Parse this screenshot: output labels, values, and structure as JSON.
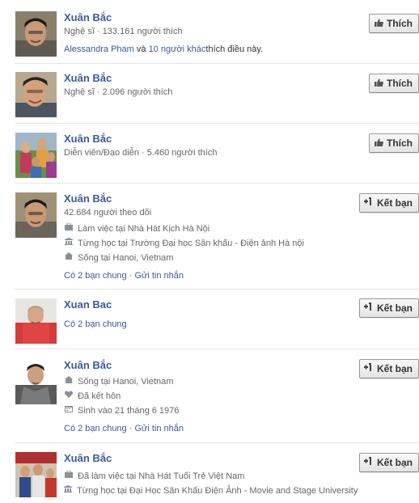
{
  "results": [
    {
      "name": "Xuân Bắc",
      "subtitle": "Nghệ sĩ · 133.161 người thích",
      "social_pre": "Alessandra Pham",
      "social_mid": " và ",
      "social_link": "10 người khác",
      "social_post": " thích điều này.",
      "button": "Thích",
      "button_icon": "thumbs-up-icon"
    },
    {
      "name": "Xuân Bắc",
      "subtitle": "Nghệ sĩ · 2.096 người thích",
      "button": "Thích",
      "button_icon": "thumbs-up-icon"
    },
    {
      "name": "Xuân Bắc",
      "subtitle": "Diễn viên/Đạo diễn · 5.460 người thích",
      "button": "Thích",
      "button_icon": "thumbs-up-icon"
    },
    {
      "name": "Xuân Bắc",
      "subtitle": "42.684 người theo dõi",
      "details": [
        {
          "icon": "briefcase-icon",
          "text": "Làm việc tại Nhà Hát Kịch Hà Nội"
        },
        {
          "icon": "school-icon",
          "text": "Từng học tại Trường Đại học Sân khấu - Điện ảnh Hà nội"
        },
        {
          "icon": "home-icon",
          "text": "Sống tại Hanoi, Vietnam"
        }
      ],
      "mutual": "Có 2 bạn chung",
      "separator": " · ",
      "message": "Gửi tin nhắn",
      "button": "Kết bạn",
      "button_icon": "add-friend-icon"
    },
    {
      "name": "Xuan Bac",
      "mutual": "Có 2 bạn chung",
      "button": "Kết bạn",
      "button_icon": "add-friend-icon"
    },
    {
      "name": "Xuân Bắc",
      "details": [
        {
          "icon": "home-icon",
          "text": "Sống tại Hanoi, Vietnam"
        },
        {
          "icon": "heart-icon",
          "text": "Đã kết hôn"
        },
        {
          "icon": "calendar-icon",
          "text": "Sinh vào 21 tháng 6 1976"
        }
      ],
      "mutual": "Có 2 bạn chung",
      "separator": " · ",
      "message": "Gửi tin nhắn",
      "button": "Kết bạn",
      "button_icon": "add-friend-icon"
    },
    {
      "name": "Xuân Bắc",
      "details": [
        {
          "icon": "briefcase-icon",
          "text": "Đã làm việc tại Nhà Hát Tuổi Trẻ Việt Nam"
        },
        {
          "icon": "school-icon",
          "text": "Từng học tại Đại Học Sân Khấu Điện Ảnh - Movie and Stage University"
        }
      ],
      "button": "Kết bạn",
      "button_icon": "add-friend-icon"
    }
  ],
  "colors": {
    "link": "#3b5998",
    "meta": "#666666",
    "separator": "#e5e5e5"
  }
}
